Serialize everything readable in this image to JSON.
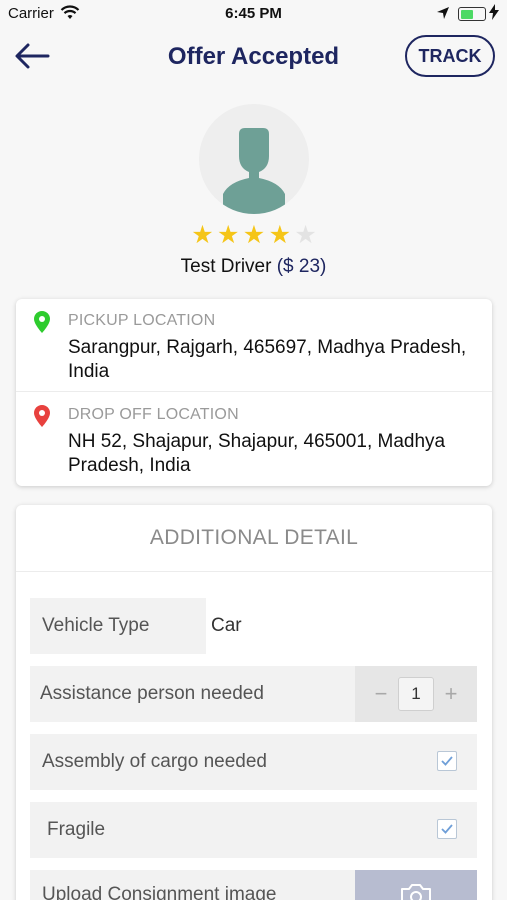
{
  "status_bar": {
    "carrier": "Carrier",
    "time": "6:45 PM"
  },
  "nav": {
    "title": "Offer Accepted",
    "track_label": "TRACK"
  },
  "driver": {
    "name": "Test Driver",
    "price": "($ 23)",
    "rating": 4,
    "rating_max": 5
  },
  "pickup": {
    "label": "PICKUP LOCATION",
    "address": "Sarangpur, Rajgarh, 465697, Madhya Pradesh, India",
    "pin_color": "#2ecc2e"
  },
  "dropoff": {
    "label": "DROP OFF LOCATION",
    "address": "NH 52, Shajapur, Shajapur, 465001, Madhya Pradesh, India",
    "pin_color": "#e8413e"
  },
  "additional_detail": {
    "title": "ADDITIONAL DETAIL",
    "vehicle_type_label": "Vehicle Type",
    "vehicle_type_value": "Car",
    "assistance_label": "Assistance person needed",
    "assistance_count": "1",
    "assembly_label": "Assembly of cargo needed",
    "assembly_checked": true,
    "fragile_label": "Fragile",
    "fragile_checked": true,
    "upload_label": "Upload Consignment image"
  },
  "colors": {
    "accent": "#1e2660",
    "star": "#f5c518",
    "avatar": "#6ea096"
  }
}
